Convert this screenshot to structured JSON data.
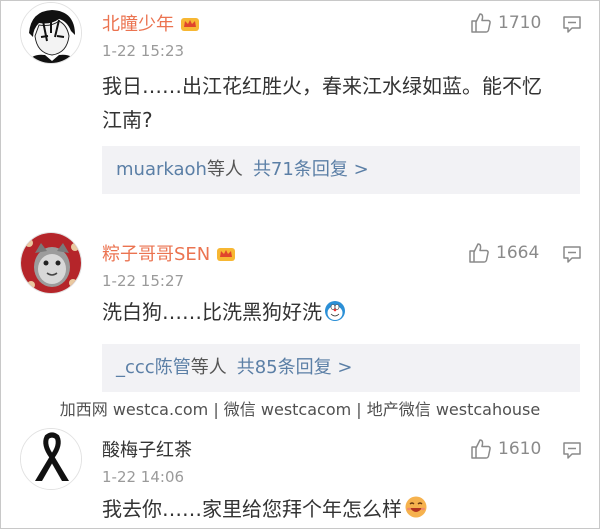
{
  "comments": [
    {
      "username": "北瞳少年",
      "time": "1-22 15:23",
      "likes": "1710",
      "text_line1": "我日……出江花红胜火，春来江水绿如蓝。能不忆",
      "text_line2": "江南?",
      "reply_user": "muarkaoh",
      "reply_mid": "等人",
      "reply_count": "共71条回复 >"
    },
    {
      "username": "粽子哥哥SEN",
      "time": "1-22 15:27",
      "likes": "1664",
      "text_line1": "洗白狗……比洗黑狗好洗",
      "reply_user": "_ccc陈管",
      "reply_mid": "等人",
      "reply_count": "共85条回复 >"
    },
    {
      "username": "酸梅子红茶",
      "time": "1-22 14:06",
      "likes": "1610",
      "text_line1": "我去你……家里给您拜个年怎么样"
    }
  ],
  "watermark": "加西网 westca.com | 微信 westcacom | 地产微信 westcahouse",
  "icons": {
    "like": "thumbs-up-icon",
    "reply": "comment-icon",
    "vip": "crown-badge-icon",
    "mourning": "black-ribbon-icon",
    "doraemon": "doraemon-emoji-icon",
    "laugh": "laughing-emoji-icon"
  },
  "colors": {
    "username": "#eb7350",
    "link": "#5b7fa6",
    "timestamp": "#9a9a9a",
    "reply_box": "#f2f2f5"
  }
}
